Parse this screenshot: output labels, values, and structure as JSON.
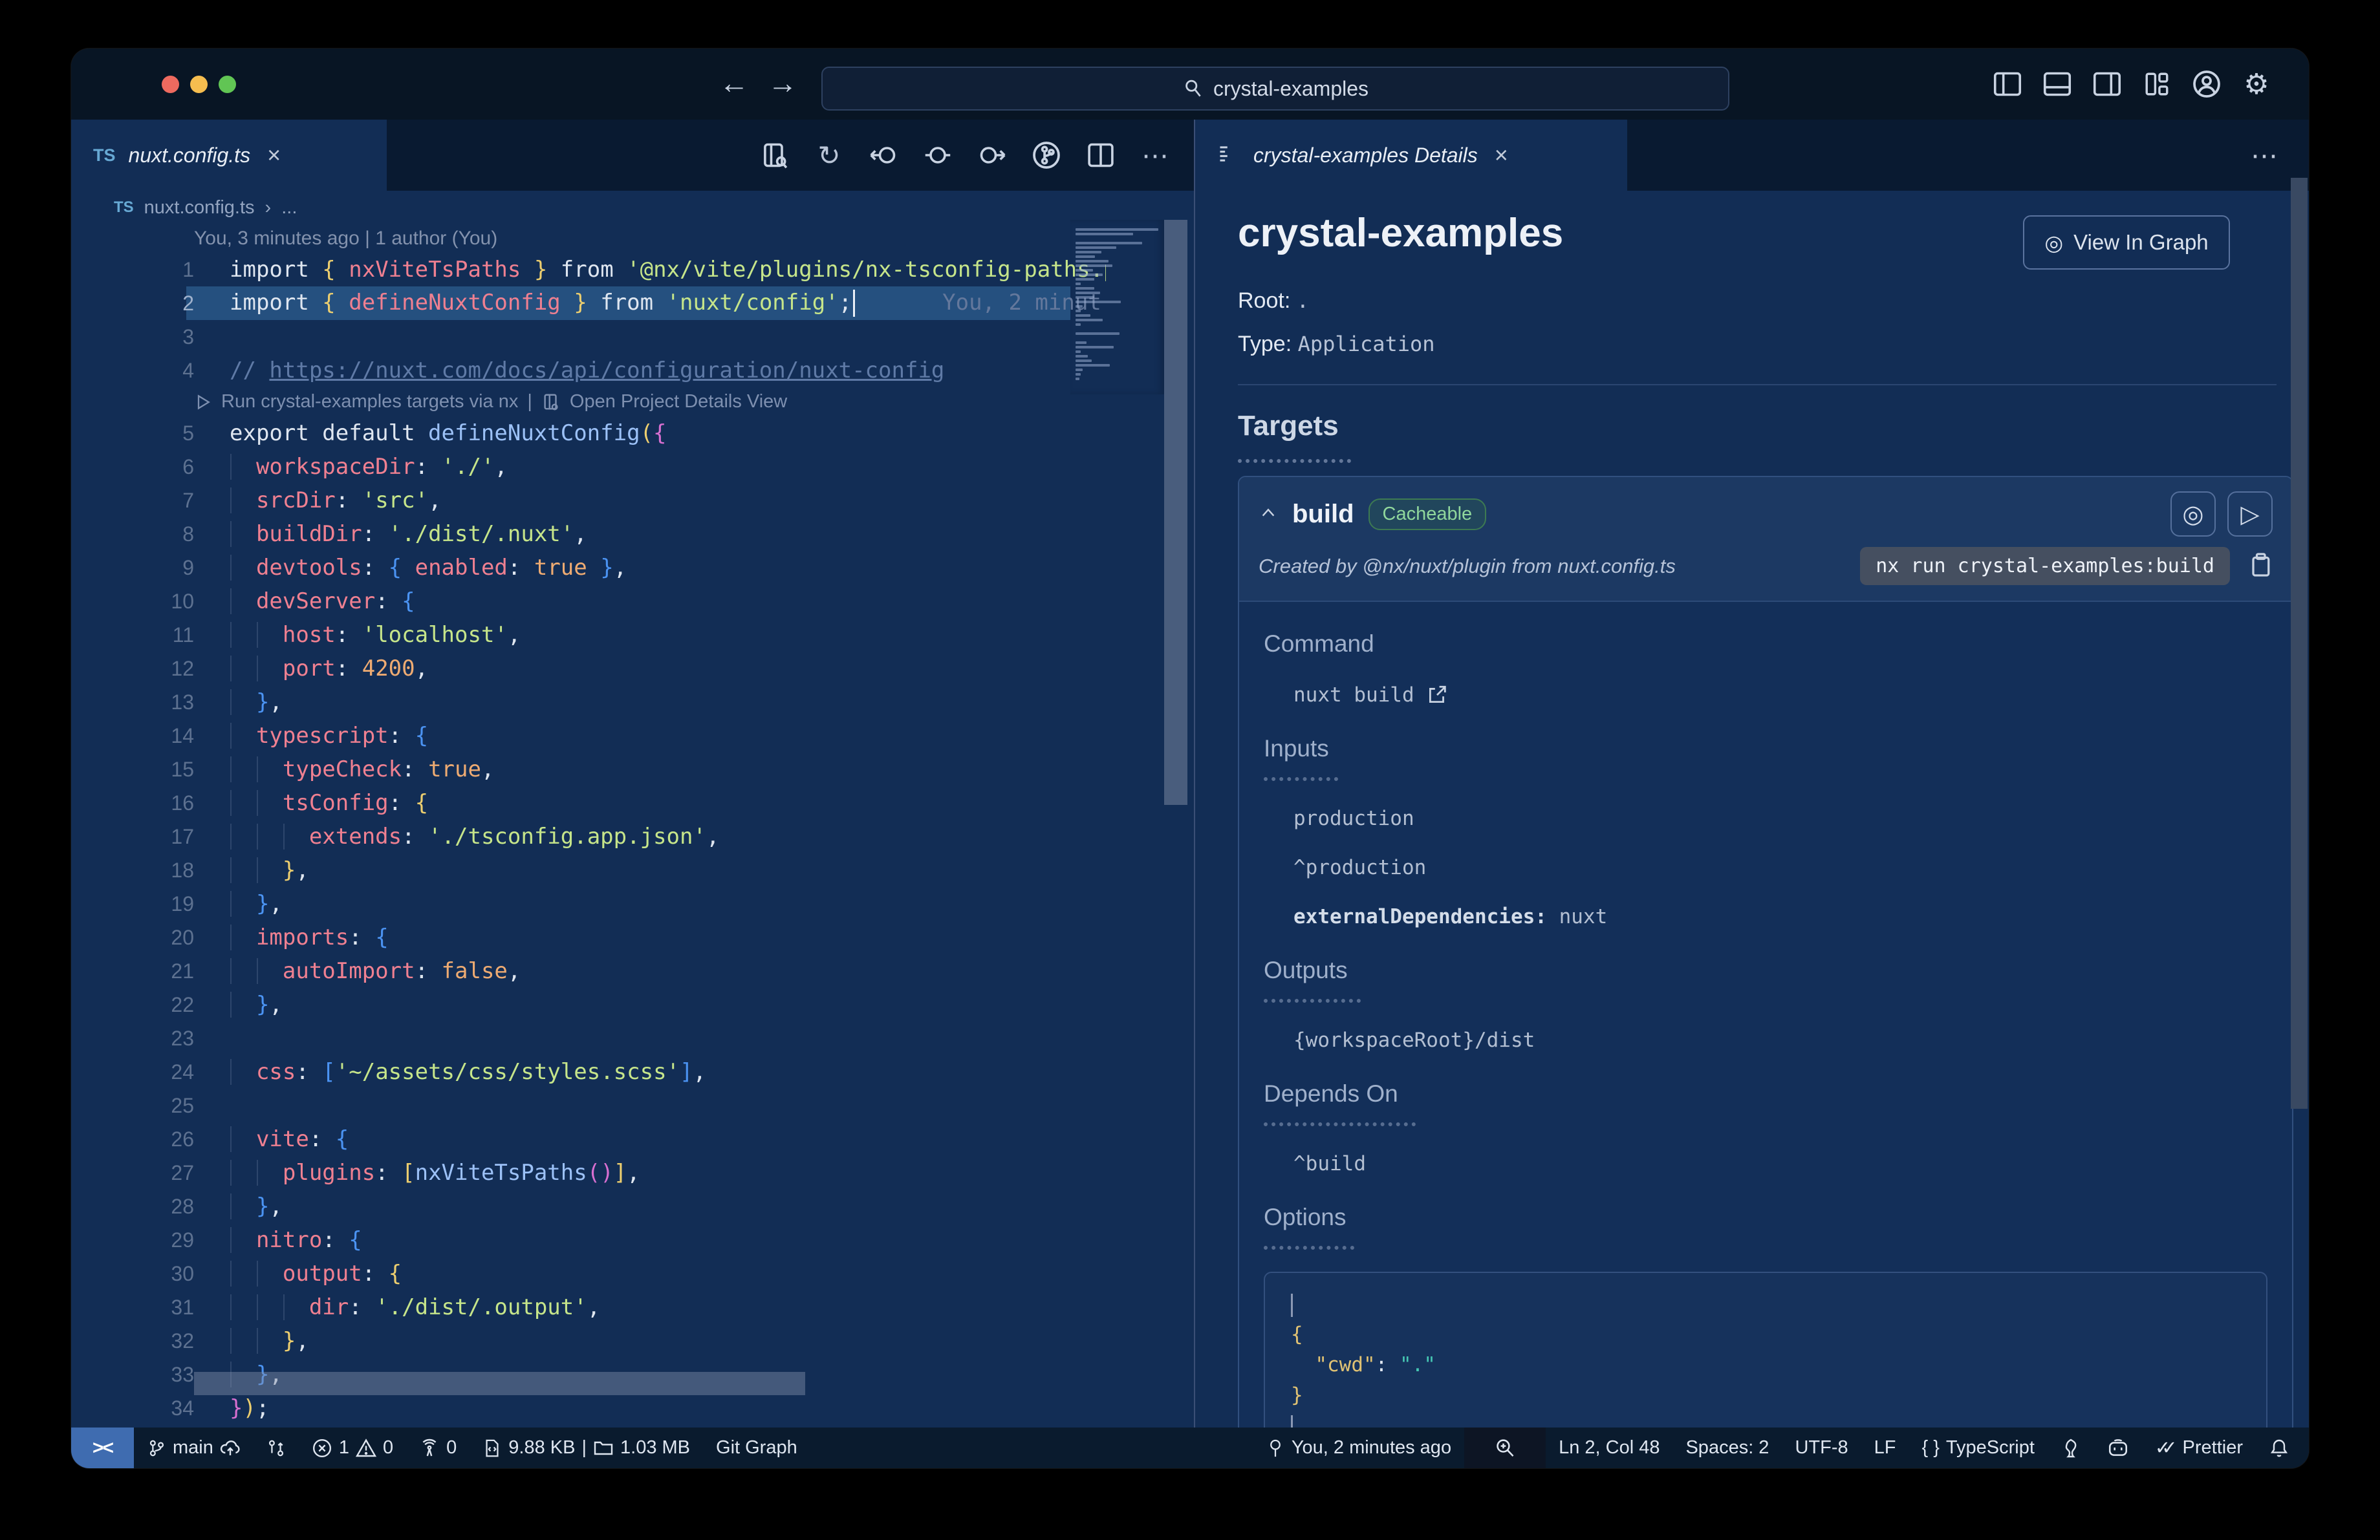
{
  "titlebar": {
    "search_value": "crystal-examples",
    "back": "←",
    "forward": "→",
    "gear": "⚙",
    "more": "⋯"
  },
  "left_tab": {
    "file_type": "TS",
    "file_name": "nuxt.config.ts",
    "close": "×"
  },
  "breadcrumb": {
    "file_type": "TS",
    "file_name": "nuxt.config.ts",
    "sep": "›",
    "ellipsis": "..."
  },
  "editor": {
    "blame_heading": "You, 3 minutes ago | 1 author (You)",
    "ghost_blame": "You, 2 minut",
    "codelens_run": "Run crystal-examples targets via nx",
    "codelens_sep": "|",
    "codelens_open": "Open Project Details View",
    "refresh_glyph": "↻",
    "rows": [
      {
        "t": "blame"
      },
      {
        "t": "c",
        "n": "1",
        "s": [
          [
            "w",
            "import "
          ],
          [
            "b1",
            "{ "
          ],
          [
            "p",
            "nxViteTsPaths"
          ],
          [
            "b1",
            " }"
          ],
          [
            "w",
            " from "
          ],
          [
            "s",
            "'@nx/vite/plugins/nx-tsconfig-paths.plugin';"
          ]
        ]
      },
      {
        "t": "c",
        "n": "2",
        "hl": true,
        "caret": true,
        "s": [
          [
            "w",
            "import "
          ],
          [
            "b1",
            "{ "
          ],
          [
            "p",
            "defineNuxtConfig"
          ],
          [
            "b1",
            " }"
          ],
          [
            "w",
            " from "
          ],
          [
            "s",
            "'nuxt/config'"
          ],
          [
            "w",
            ";"
          ]
        ]
      },
      {
        "t": "c",
        "n": "3",
        "s": []
      },
      {
        "t": "c",
        "n": "4",
        "s": [
          [
            "c",
            "// "
          ],
          [
            "cu",
            "https://nuxt.com/docs/api/configuration/nuxt-config"
          ]
        ]
      },
      {
        "t": "lens"
      },
      {
        "t": "c",
        "n": "5",
        "s": [
          [
            "w",
            "export default "
          ],
          [
            "fn",
            "defineNuxtConfig"
          ],
          [
            "b1",
            "("
          ],
          [
            "b2",
            "{"
          ]
        ]
      },
      {
        "t": "c",
        "n": "6",
        "s": [
          [
            "p",
            "  workspaceDir"
          ],
          [
            "w",
            ": "
          ],
          [
            "s",
            "'./'"
          ],
          [
            "w",
            ","
          ]
        ]
      },
      {
        "t": "c",
        "n": "7",
        "s": [
          [
            "p",
            "  srcDir"
          ],
          [
            "w",
            ": "
          ],
          [
            "s",
            "'src'"
          ],
          [
            "w",
            ","
          ]
        ]
      },
      {
        "t": "c",
        "n": "8",
        "s": [
          [
            "p",
            "  buildDir"
          ],
          [
            "w",
            ": "
          ],
          [
            "s",
            "'./dist/.nuxt'"
          ],
          [
            "w",
            ","
          ]
        ]
      },
      {
        "t": "c",
        "n": "9",
        "s": [
          [
            "p",
            "  devtools"
          ],
          [
            "w",
            ": "
          ],
          [
            "b3",
            "{ "
          ],
          [
            "p",
            "enabled"
          ],
          [
            "w",
            ": "
          ],
          [
            "o",
            "true"
          ],
          [
            "b3",
            " }"
          ],
          [
            "w",
            ","
          ]
        ]
      },
      {
        "t": "c",
        "n": "10",
        "s": [
          [
            "p",
            "  devServer"
          ],
          [
            "w",
            ": "
          ],
          [
            "b3",
            "{"
          ]
        ]
      },
      {
        "t": "c",
        "n": "11",
        "s": [
          [
            "p",
            "    host"
          ],
          [
            "w",
            ": "
          ],
          [
            "s",
            "'localhost'"
          ],
          [
            "w",
            ","
          ]
        ]
      },
      {
        "t": "c",
        "n": "12",
        "s": [
          [
            "p",
            "    port"
          ],
          [
            "w",
            ": "
          ],
          [
            "o",
            "4200"
          ],
          [
            "w",
            ","
          ]
        ]
      },
      {
        "t": "c",
        "n": "13",
        "s": [
          [
            "b3",
            "  }"
          ],
          [
            "w",
            ","
          ]
        ]
      },
      {
        "t": "c",
        "n": "14",
        "s": [
          [
            "p",
            "  typescript"
          ],
          [
            "w",
            ": "
          ],
          [
            "b3",
            "{"
          ]
        ]
      },
      {
        "t": "c",
        "n": "15",
        "s": [
          [
            "p",
            "    typeCheck"
          ],
          [
            "w",
            ": "
          ],
          [
            "o",
            "true"
          ],
          [
            "w",
            ","
          ]
        ]
      },
      {
        "t": "c",
        "n": "16",
        "s": [
          [
            "p",
            "    tsConfig"
          ],
          [
            "w",
            ": "
          ],
          [
            "b1",
            "{"
          ]
        ]
      },
      {
        "t": "c",
        "n": "17",
        "s": [
          [
            "p",
            "      extends"
          ],
          [
            "w",
            ": "
          ],
          [
            "s",
            "'./tsconfig.app.json'"
          ],
          [
            "w",
            ","
          ]
        ]
      },
      {
        "t": "c",
        "n": "18",
        "s": [
          [
            "b1",
            "    }"
          ],
          [
            "w",
            ","
          ]
        ]
      },
      {
        "t": "c",
        "n": "19",
        "s": [
          [
            "b3",
            "  }"
          ],
          [
            "w",
            ","
          ]
        ]
      },
      {
        "t": "c",
        "n": "20",
        "s": [
          [
            "p",
            "  imports"
          ],
          [
            "w",
            ": "
          ],
          [
            "b3",
            "{"
          ]
        ]
      },
      {
        "t": "c",
        "n": "21",
        "s": [
          [
            "p",
            "    autoImport"
          ],
          [
            "w",
            ": "
          ],
          [
            "o",
            "false"
          ],
          [
            "w",
            ","
          ]
        ]
      },
      {
        "t": "c",
        "n": "22",
        "s": [
          [
            "b3",
            "  }"
          ],
          [
            "w",
            ","
          ]
        ]
      },
      {
        "t": "c",
        "n": "23",
        "s": [],
        "g": 1
      },
      {
        "t": "c",
        "n": "24",
        "s": [
          [
            "p",
            "  css"
          ],
          [
            "w",
            ": "
          ],
          [
            "b3",
            "["
          ],
          [
            "s",
            "'~/assets/css/styles.scss'"
          ],
          [
            "b3",
            "]"
          ],
          [
            "w",
            ","
          ]
        ]
      },
      {
        "t": "c",
        "n": "25",
        "s": [],
        "g": 1
      },
      {
        "t": "c",
        "n": "26",
        "s": [
          [
            "p",
            "  vite"
          ],
          [
            "w",
            ": "
          ],
          [
            "b3",
            "{"
          ]
        ]
      },
      {
        "t": "c",
        "n": "27",
        "s": [
          [
            "p",
            "    plugins"
          ],
          [
            "w",
            ": "
          ],
          [
            "b1",
            "["
          ],
          [
            "fn",
            "nxViteTsPaths"
          ],
          [
            "b2",
            "()"
          ],
          [
            "b1",
            "]"
          ],
          [
            "w",
            ","
          ]
        ]
      },
      {
        "t": "c",
        "n": "28",
        "s": [
          [
            "b3",
            "  }"
          ],
          [
            "w",
            ","
          ]
        ]
      },
      {
        "t": "c",
        "n": "29",
        "s": [
          [
            "p",
            "  nitro"
          ],
          [
            "w",
            ": "
          ],
          [
            "b3",
            "{"
          ]
        ]
      },
      {
        "t": "c",
        "n": "30",
        "s": [
          [
            "p",
            "    output"
          ],
          [
            "w",
            ": "
          ],
          [
            "b1",
            "{"
          ]
        ]
      },
      {
        "t": "c",
        "n": "31",
        "s": [
          [
            "p",
            "      dir"
          ],
          [
            "w",
            ": "
          ],
          [
            "s",
            "'./dist/.output'"
          ],
          [
            "w",
            ","
          ]
        ]
      },
      {
        "t": "c",
        "n": "32",
        "s": [
          [
            "b1",
            "    }"
          ],
          [
            "w",
            ","
          ]
        ]
      },
      {
        "t": "c",
        "n": "33",
        "s": [
          [
            "b3",
            "  }"
          ],
          [
            "w",
            ","
          ]
        ]
      },
      {
        "t": "c",
        "n": "34",
        "s": [
          [
            "b2",
            "}"
          ],
          [
            "b1",
            ")"
          ],
          [
            "w",
            ";"
          ]
        ]
      }
    ]
  },
  "panel": {
    "tab_label": "crystal-examples Details",
    "close": "×",
    "more": "⋯",
    "title": "crystal-examples",
    "view_in_graph": "View In Graph",
    "eye_glyph": "◎",
    "play_glyph": "▷",
    "root_label": "Root:",
    "root_value": ".",
    "type_label": "Type:",
    "type_value": "Application",
    "targets_heading": "Targets",
    "build": {
      "name": "build",
      "badge": "Cacheable",
      "created_by": "Created by @nx/nuxt/plugin from nuxt.config.ts",
      "command_pill": "nx run crystal-examples:build",
      "command_heading": "Command",
      "command_value": "nuxt build",
      "inputs_heading": "Inputs",
      "inputs": [
        "production",
        "^production"
      ],
      "inputs_kv_key": "externalDependencies:",
      "inputs_kv_value": " nuxt",
      "outputs_heading": "Outputs",
      "outputs": [
        "{workspaceRoot}/dist"
      ],
      "depends_heading": "Depends On",
      "depends": [
        "^build"
      ],
      "options_heading": "Options",
      "options_code": [
        {
          "bar": true
        },
        {
          "s": [
            [
              "b1",
              "{"
            ]
          ]
        },
        {
          "s": [
            [
              "ok",
              "  \"cwd\""
            ],
            [
              "w",
              ": "
            ],
            [
              "ov",
              "\".\""
            ]
          ]
        },
        {
          "s": [
            [
              "b1",
              "}"
            ]
          ]
        },
        {
          "bar": true
        }
      ]
    }
  },
  "statusbar": {
    "remote_icon": "><",
    "branch": "main",
    "errors": "1",
    "warnings": "0",
    "ports": "0",
    "file_size": "9.88 KB",
    "sep": "|",
    "folder_size": "1.03 MB",
    "git_graph": "Git Graph",
    "blame": "You, 2 minutes ago",
    "cursor": "Ln 2, Col 48",
    "spaces": "Spaces: 2",
    "encoding": "UTF-8",
    "eol": "LF",
    "lang_icon": "{ }",
    "language": "TypeScript",
    "check": "✓✓",
    "prettier": "Prettier"
  }
}
